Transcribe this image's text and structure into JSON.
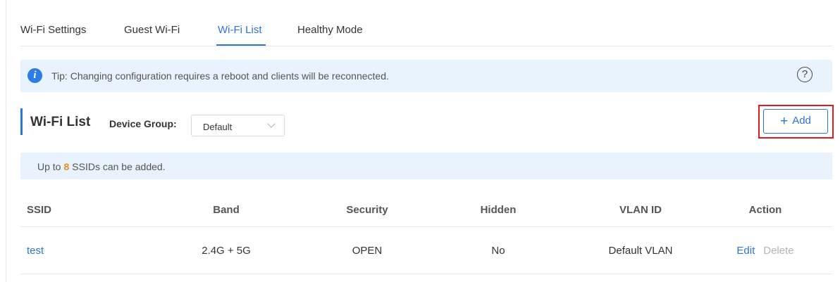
{
  "tabs": [
    {
      "label": "Wi-Fi Settings",
      "active": false
    },
    {
      "label": "Guest Wi-Fi",
      "active": false
    },
    {
      "label": "Wi-Fi List",
      "active": true
    },
    {
      "label": "Healthy Mode",
      "active": false
    }
  ],
  "tip": {
    "text": "Tip: Changing configuration requires a reboot and clients will be reconnected.",
    "info_icon_glyph": "i",
    "help_icon_glyph": "?"
  },
  "section": {
    "title": "Wi-Fi List",
    "device_group_label": "Device Group:",
    "device_group_value": "Default",
    "add_button_label": "Add",
    "add_button_icon": "+"
  },
  "info": {
    "prefix": "Up to",
    "count": "8",
    "suffix": "SSIDs can be added."
  },
  "table": {
    "headers": [
      "SSID",
      "Band",
      "Security",
      "Hidden",
      "VLAN ID",
      "Action"
    ],
    "rows": [
      {
        "ssid": "test",
        "band": "2.4G + 5G",
        "security": "OPEN",
        "hidden": "No",
        "vlan": "Default VLAN",
        "edit": "Edit",
        "delete": "Delete"
      }
    ]
  },
  "colors": {
    "accent": "#2a75d8",
    "tip_bg": "#e8f3fd",
    "highlight_outline": "#e01b1b",
    "count_color": "#ef8a1e"
  }
}
